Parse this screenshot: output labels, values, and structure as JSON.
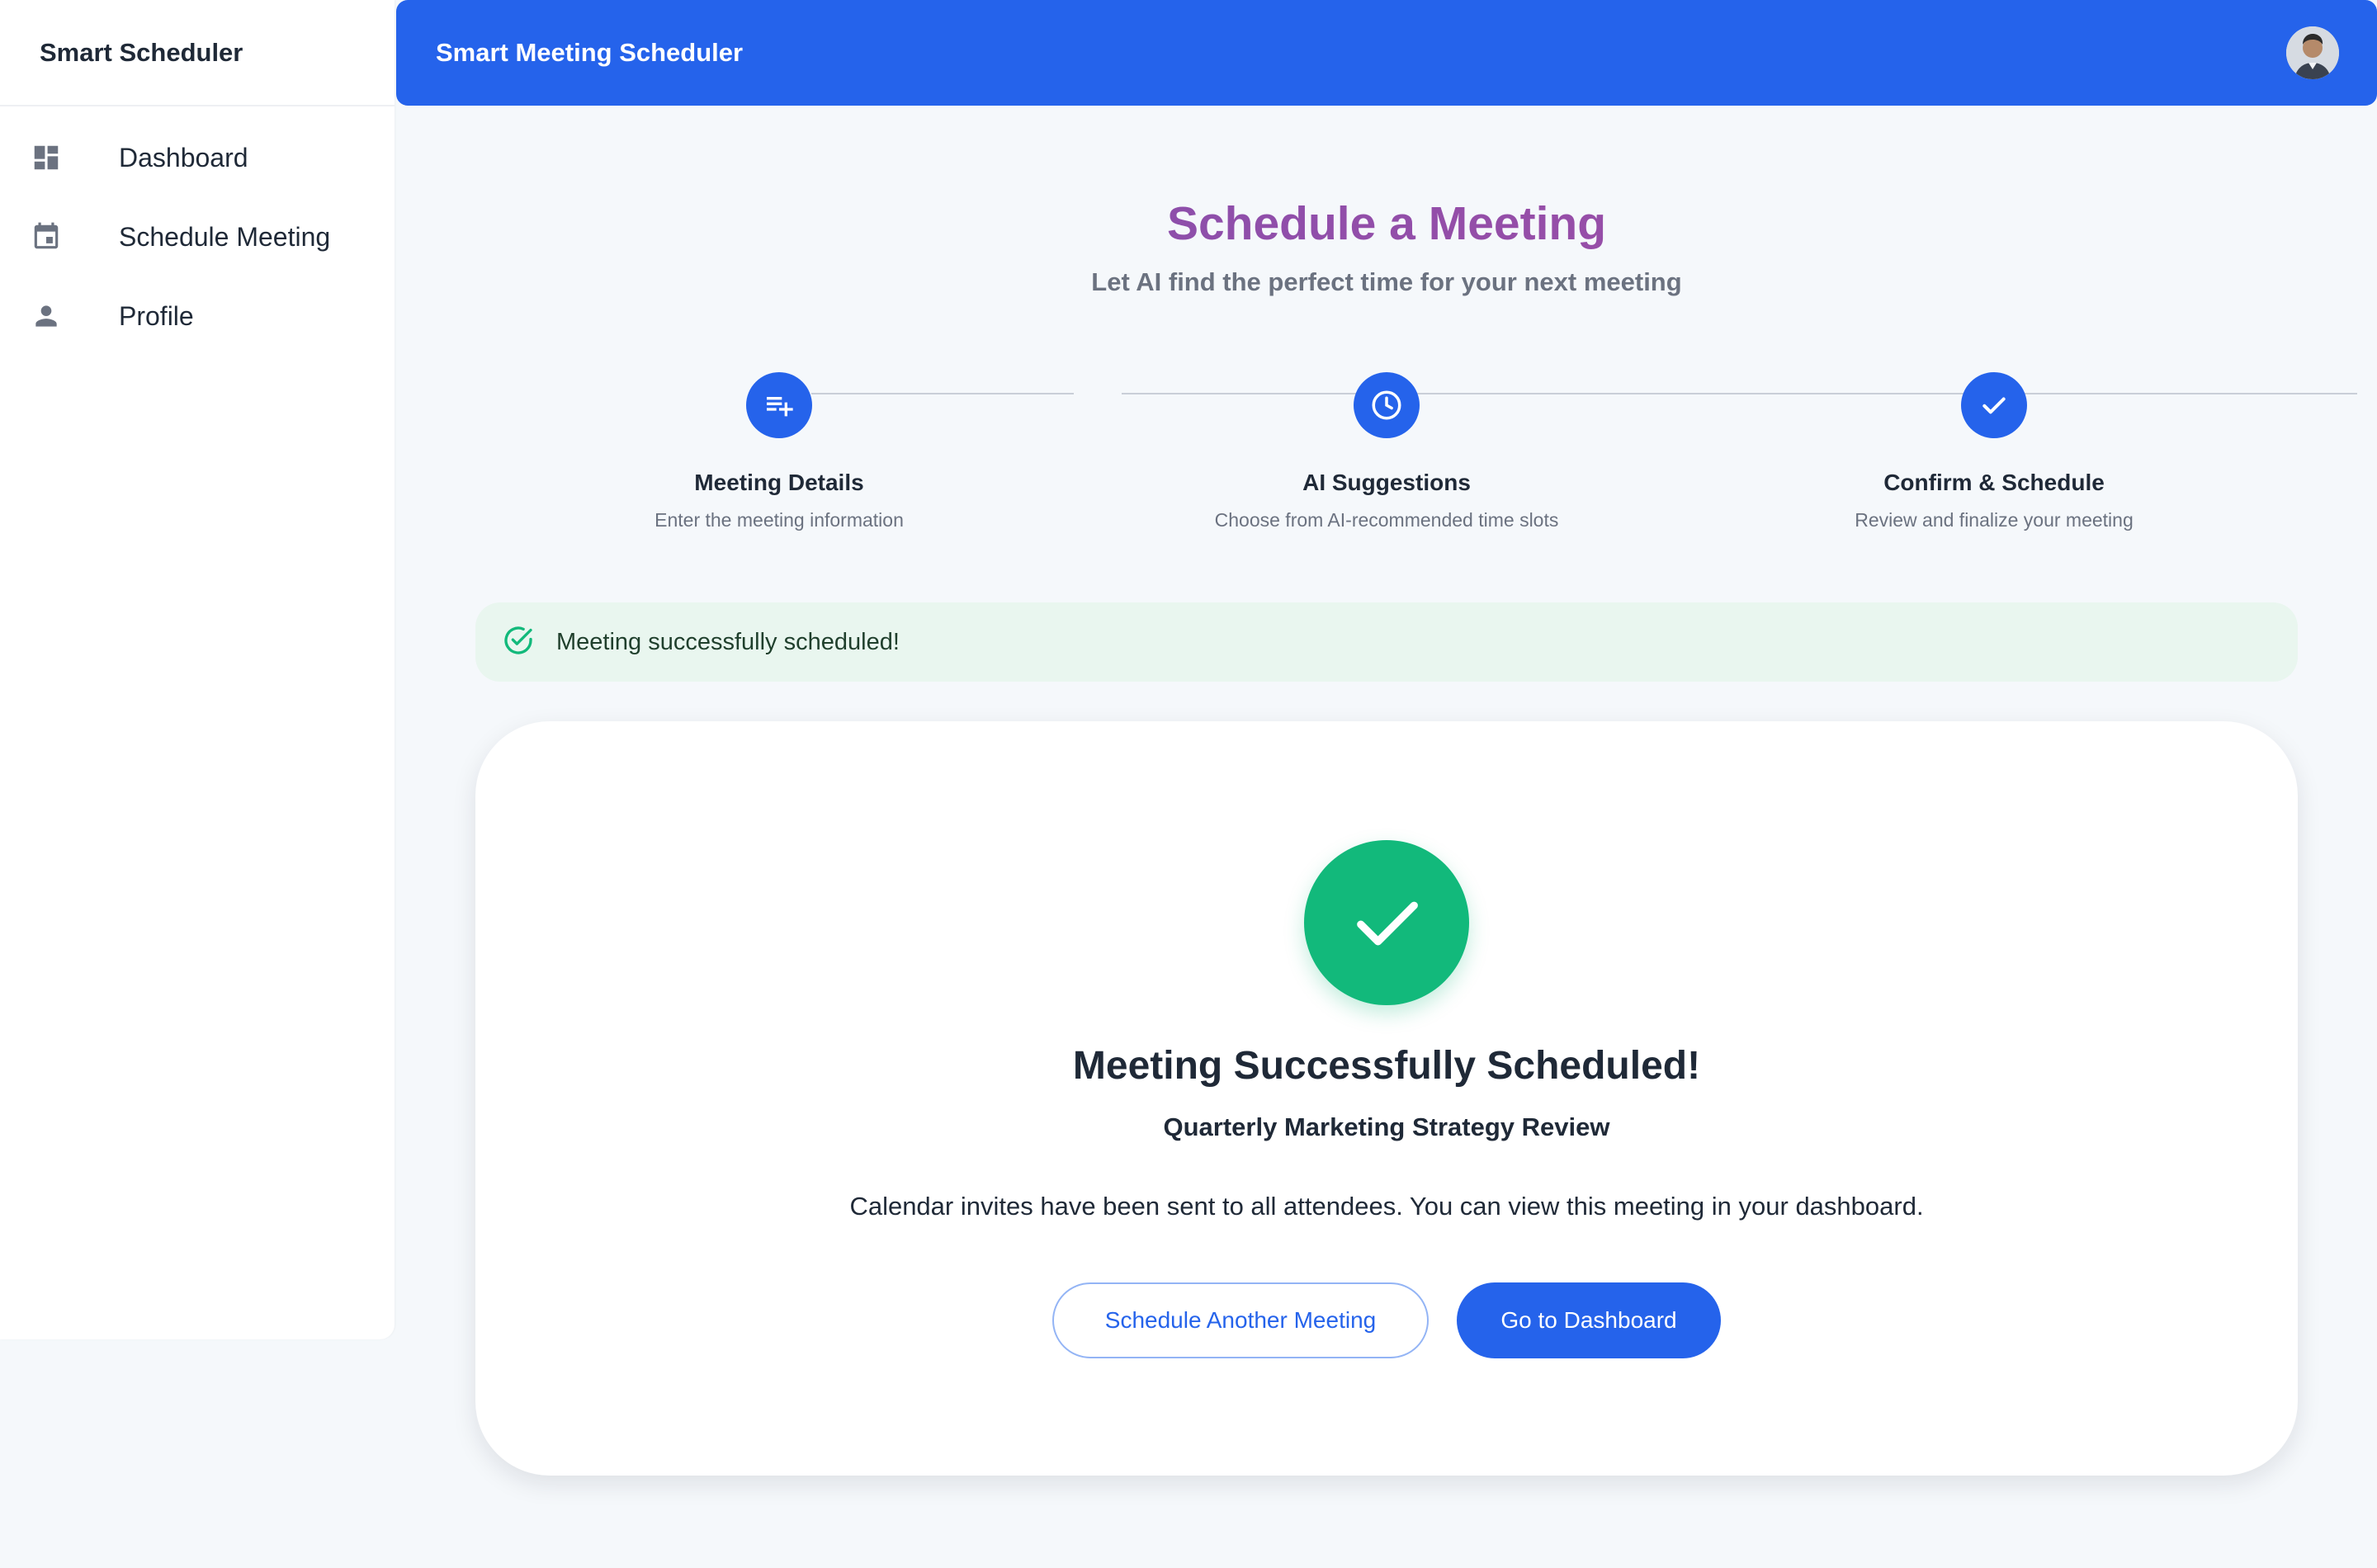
{
  "sidebar": {
    "brand": "Smart Scheduler",
    "items": [
      {
        "label": "Dashboard",
        "icon": "dashboard-icon"
      },
      {
        "label": "Schedule Meeting",
        "icon": "calendar-icon"
      },
      {
        "label": "Profile",
        "icon": "person-icon"
      }
    ]
  },
  "header": {
    "title": "Smart Meeting Scheduler",
    "avatar": "user-avatar"
  },
  "page": {
    "title": "Schedule a Meeting",
    "subtitle": "Let AI find the perfect time for your next meeting"
  },
  "steps": [
    {
      "title": "Meeting Details",
      "desc": "Enter the meeting information",
      "icon": "playlist-add-icon"
    },
    {
      "title": "AI Suggestions",
      "desc": "Choose from AI-recommended time slots",
      "icon": "clock-icon"
    },
    {
      "title": "Confirm & Schedule",
      "desc": "Review and finalize your meeting",
      "icon": "check-icon"
    }
  ],
  "alert": {
    "text": "Meeting successfully scheduled!",
    "icon": "check-circle-icon"
  },
  "card": {
    "title": "Meeting Successfully Scheduled!",
    "meeting_name": "Quarterly Marketing Strategy Review",
    "message": "Calendar invites have been sent to all attendees. You can view this meeting in your dashboard.",
    "secondary_button": "Schedule Another Meeting",
    "primary_button": "Go to Dashboard"
  },
  "colors": {
    "primary": "#2563eb",
    "success": "#12b97b",
    "title_gradient_start": "#7e4fb0",
    "title_gradient_end": "#a64ea2"
  }
}
